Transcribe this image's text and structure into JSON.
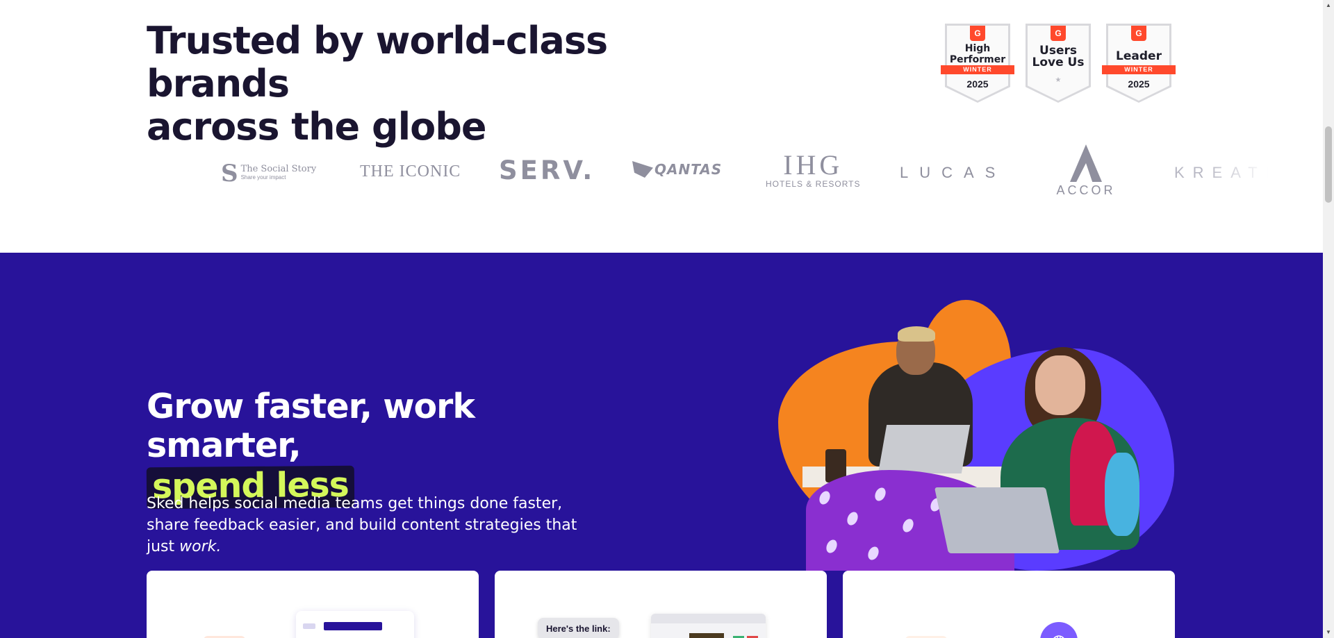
{
  "trusted": {
    "heading_line1": "Trusted by world-class brands",
    "heading_line2": "across the globe",
    "badges": [
      {
        "brand": "G",
        "title_line1": "High",
        "title_line2": "Performer",
        "ribbon": "WINTER",
        "year": "2025"
      },
      {
        "brand": "G",
        "title_line1": "Users",
        "title_line2": "Love Us",
        "star": "★"
      },
      {
        "brand": "G",
        "title_line1": "Leader",
        "ribbon": "WINTER",
        "year": "2025"
      }
    ],
    "logos": {
      "social_story_mark": "S",
      "social_story_name": "The Social Story",
      "social_story_tagline": "Share your impact",
      "iconic": "THE ICONIC",
      "serv": "SERV.",
      "qantas": "QANTAS",
      "ihg_main": "IHG",
      "ihg_sub": "HOTELS & RESORTS",
      "lucas": "LUCAS",
      "accor": "ACCOR",
      "kreate": "KREATE"
    }
  },
  "hero": {
    "heading_line1": "Grow faster, work smarter,",
    "heading_highlight": "spend less",
    "body_text": "Sked helps social media teams get things done faster, share feedback easier, and build content strategies that just ",
    "body_emphasis": "work."
  },
  "cards": {
    "card2_bubble": "Here's the link:",
    "card3_icon": "globe-icon"
  },
  "colors": {
    "hero_bg": "#28139a",
    "highlight_text": "#d4f75a",
    "g2_red": "#ff492c",
    "heading_dark": "#1a1530"
  },
  "scrollbar": {
    "up_arrow": "▲",
    "down_arrow": "▼"
  }
}
